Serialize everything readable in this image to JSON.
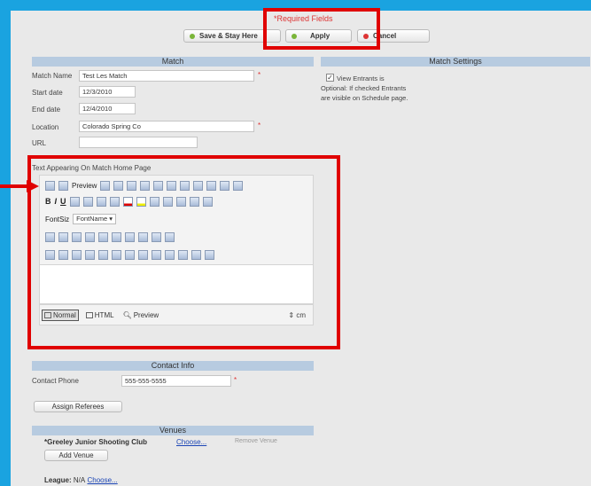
{
  "header": {
    "required_note": "*Required Fields",
    "buttons": {
      "save_stay": "Save & Stay Here",
      "apply": "Apply",
      "cancel": "Cancel"
    }
  },
  "match": {
    "section_title": "Match",
    "fields": {
      "name_label": "Match Name",
      "name_value": "Test Les Match",
      "start_label": "Start date",
      "start_value": "12/3/2010",
      "end_label": "End date",
      "end_value": "12/4/2010",
      "location_label": "Location",
      "location_value": "Colorado Spring Co",
      "url_label": "URL",
      "url_value": ""
    }
  },
  "settings": {
    "section_title": "Match Settings",
    "view_entrants_checked": "✓",
    "view_entrants_text": "View Entrants is Optional: If checked Entrants are visible on Schedule page."
  },
  "editor": {
    "label": "Text Appearing On Match Home Page",
    "preview_label": "Preview",
    "font_size_label": "FontSiz",
    "font_name_label": "FontName",
    "bold": "B",
    "italic": "I",
    "underline": "U",
    "modes": {
      "normal": "Normal",
      "html": "HTML",
      "preview": "Preview"
    },
    "resize_label": "cm"
  },
  "contact": {
    "section_title": "Contact Info",
    "phone_label": "Contact Phone",
    "phone_value": "555-555-5555",
    "assign_referees": "Assign Referees"
  },
  "venues": {
    "section_title": "Venues",
    "venue_name": "*Greeley Junior Shooting Club",
    "choose": "Choose...",
    "remove": "Remove Venue",
    "add_venue": "Add Venue"
  },
  "league": {
    "label": "League:",
    "value": "N/A",
    "choose": "Choose..."
  },
  "colors": {
    "frame": "#1aa3e0",
    "highlight": "#e00000",
    "section_bar": "#b7cbe0"
  }
}
